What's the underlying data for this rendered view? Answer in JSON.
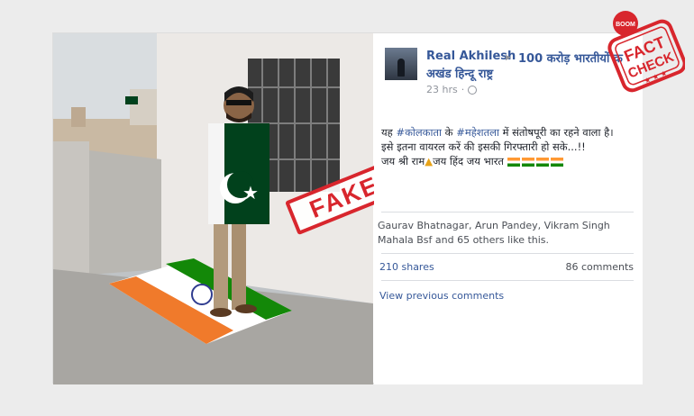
{
  "post": {
    "author": "Real Akhilesh",
    "group_line1": "100 करोड़ भारतीयों क",
    "group_line2": "अखंड हिन्दू राष्ट्र",
    "time": "23 hrs",
    "body_prefix": "यह ",
    "hashtag1": "#कोलकाता",
    "body_mid": " के ",
    "hashtag2": "#महेशतला",
    "body_line1_rest": " में संतोषपूरी का रहने वाला है।",
    "body_line2": "इसे इतना वायरल करें की इसकी गिरफ्तारी हो सके...!!",
    "body_line3a": "जय श्री राम",
    "body_line3b": "जय हिंद जय भारत",
    "likes_text": "Gaurav Bhatnagar, Arun Pandey, Vikram Singh Mahala Bsf and 65 others like this.",
    "shares": "210 shares",
    "comments": "86 comments",
    "view_previous": "View previous comments"
  },
  "stamp": {
    "fake": "FAKE"
  },
  "badge": {
    "boom": "BOOM",
    "fact": "FACT",
    "check": "CHECK"
  },
  "colors": {
    "link": "#365899",
    "stamp_red": "#d8262d",
    "pak_green": "#01411c",
    "saffron": "#ff9933",
    "india_green": "#138808"
  }
}
